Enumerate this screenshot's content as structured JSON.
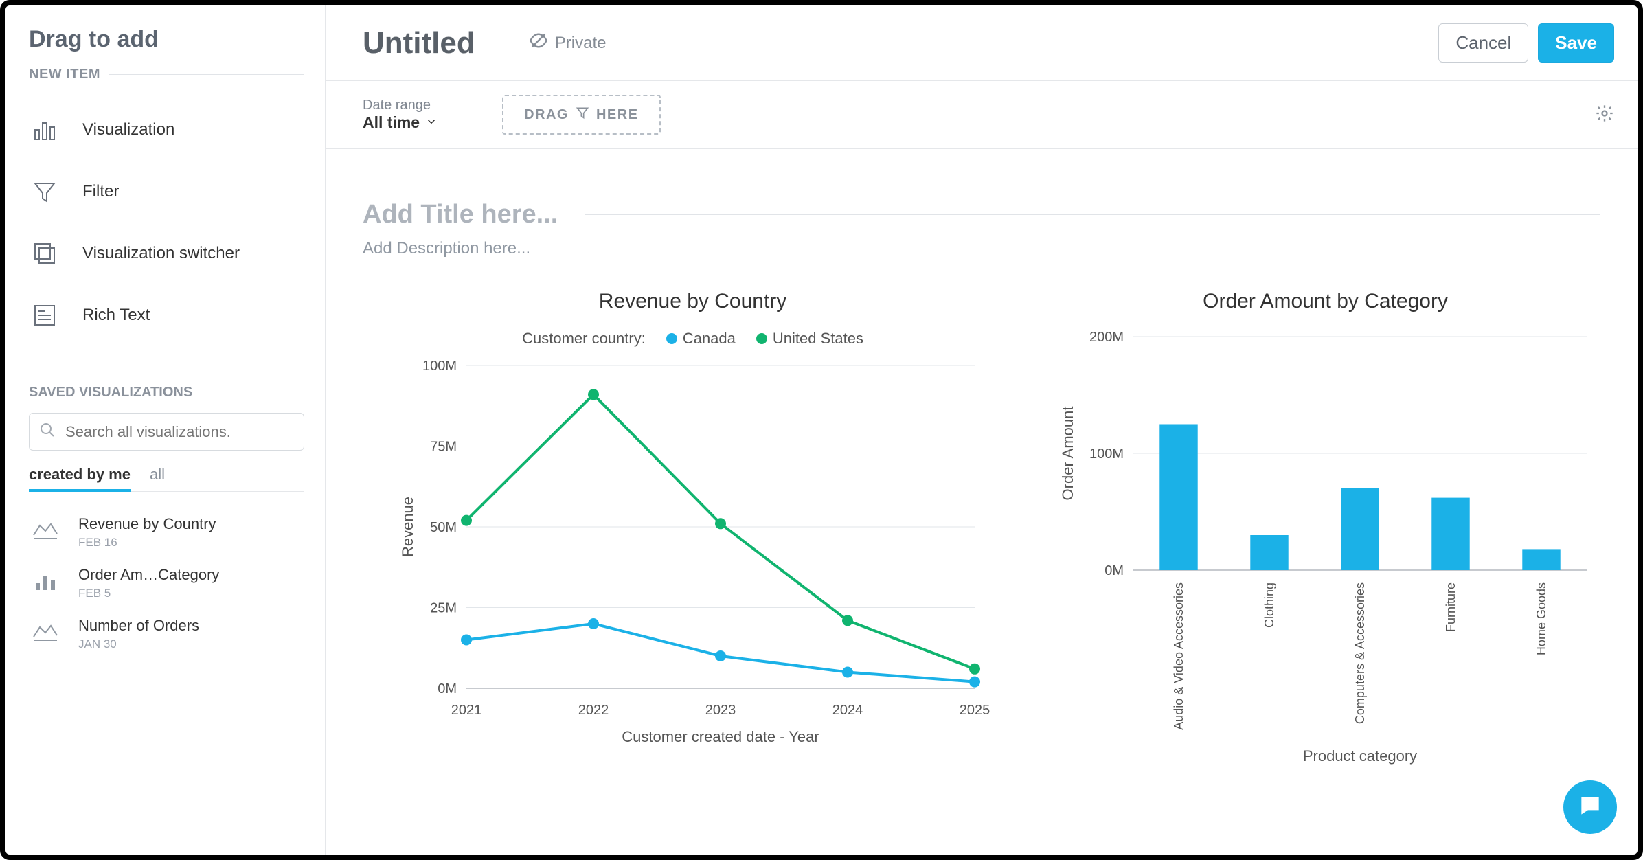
{
  "sidebar": {
    "title": "Drag to add",
    "new_item_header": "NEW ITEM",
    "items": [
      {
        "label": "Visualization",
        "icon": "bar-chart-icon"
      },
      {
        "label": "Filter",
        "icon": "filter-icon"
      },
      {
        "label": "Visualization switcher",
        "icon": "switcher-icon"
      },
      {
        "label": "Rich Text",
        "icon": "rich-text-icon"
      }
    ],
    "saved_header": "SAVED VISUALIZATIONS",
    "search_placeholder": "Search all visualizations.",
    "tabs": {
      "created_by_me": "created by me",
      "all": "all",
      "active": "created_by_me"
    },
    "saved": [
      {
        "title": "Revenue by Country",
        "date": "FEB 16",
        "icon": "line-icon"
      },
      {
        "title": "Order Am…Category",
        "date": "FEB 5",
        "icon": "bars-icon"
      },
      {
        "title": "Number of Orders",
        "date": "JAN 30",
        "icon": "line-icon"
      }
    ]
  },
  "header": {
    "title": "Untitled",
    "privacy": "Private",
    "cancel": "Cancel",
    "save": "Save"
  },
  "filterbar": {
    "date_range_label": "Date range",
    "date_range_value": "All time",
    "drag_left": "DRAG",
    "drag_right": "HERE"
  },
  "content": {
    "title_placeholder": "Add Title here...",
    "desc_placeholder": "Add Description here..."
  },
  "chart_data": [
    {
      "type": "line",
      "title": "Revenue by Country",
      "legend_label": "Customer country:",
      "xlabel": "Customer created date - Year",
      "ylabel": "Revenue",
      "categories": [
        "2021",
        "2022",
        "2023",
        "2024",
        "2025"
      ],
      "yticks": [
        0,
        25,
        50,
        75,
        100
      ],
      "ytick_suffix": "M",
      "ylim": [
        0,
        100
      ],
      "colors": {
        "Canada": "#1bb1e7",
        "United States": "#10b46f"
      },
      "series": [
        {
          "name": "Canada",
          "values": [
            15,
            20,
            10,
            5,
            2
          ]
        },
        {
          "name": "United States",
          "values": [
            52,
            91,
            51,
            21,
            6
          ]
        }
      ]
    },
    {
      "type": "bar",
      "title": "Order Amount by Category",
      "xlabel": "Product category",
      "ylabel": "Order Amount",
      "categories": [
        "Audio & Video Accessories",
        "Clothing",
        "Computers & Accessories",
        "Furniture",
        "Home Goods"
      ],
      "yticks": [
        0,
        100,
        200
      ],
      "ytick_suffix": "M",
      "ylim": [
        0,
        200
      ],
      "color": "#1bb1e7",
      "values": [
        125,
        30,
        70,
        62,
        18
      ]
    }
  ]
}
